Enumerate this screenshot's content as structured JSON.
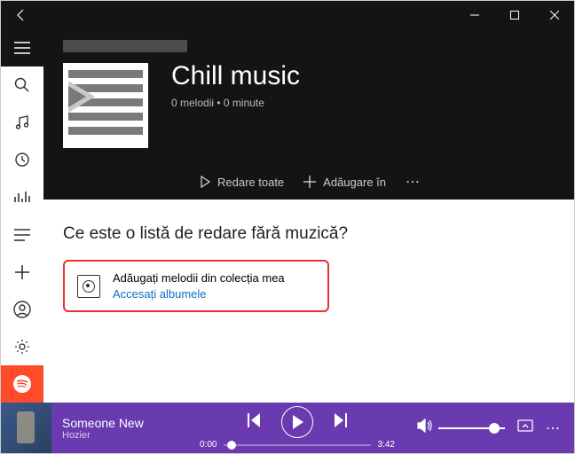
{
  "titlebar": {
    "back_icon": "←"
  },
  "sidebar": {
    "items": [
      "menu",
      "search",
      "music",
      "recent",
      "now-playing",
      "playlists",
      "add",
      "account",
      "settings",
      "spotify"
    ]
  },
  "playlist": {
    "title": "Chill music",
    "meta": "0 melodii • 0 minute"
  },
  "actions": {
    "play_all": "Redare toate",
    "add_to": "Adăugare în",
    "more": "⋯"
  },
  "empty": {
    "heading": "Ce este o listă de redare fără muzică?",
    "card_text": "Adăugați melodii din colecția mea",
    "card_link": "Accesați albumele"
  },
  "player": {
    "track_title": "Someone New",
    "track_artist": "Hozier",
    "time_current": "0:00",
    "time_total": "3:42"
  }
}
